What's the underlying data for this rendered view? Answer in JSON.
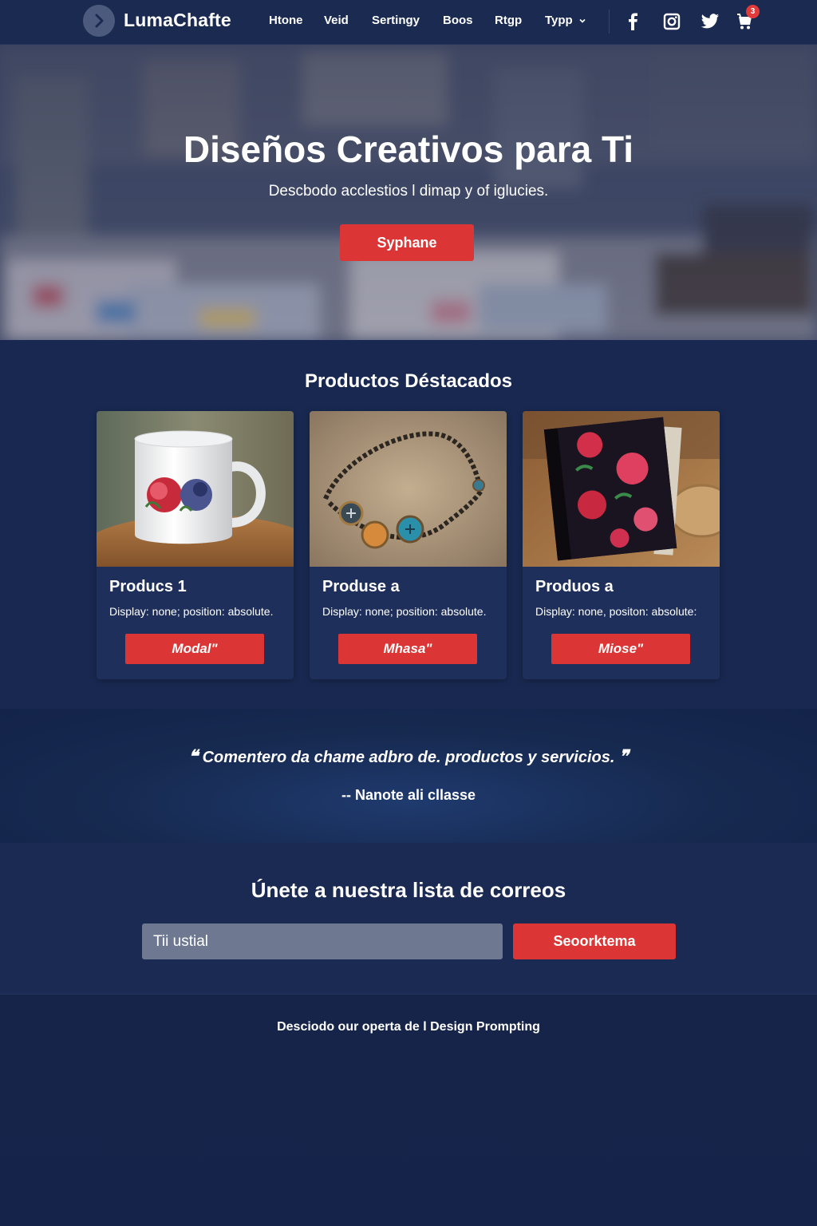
{
  "nav": {
    "brand": "LumaChafte",
    "items": [
      {
        "label": "Htone"
      },
      {
        "label": "Veid"
      },
      {
        "label": "Sertingy"
      },
      {
        "label": "Boos"
      },
      {
        "label": "Rtgp"
      },
      {
        "label": "Typp"
      }
    ],
    "social_icons": [
      "facebook-icon",
      "instagram-icon",
      "twitter-icon",
      "cart-icon"
    ],
    "cart_badge": "3"
  },
  "hero": {
    "title": "Diseños Creativos para Ti",
    "subtitle": "Descbodo acclestios l dimap y of iglucies.",
    "cta_label": "Syphane"
  },
  "products": {
    "heading": "Productos Déstacados",
    "items": [
      {
        "title": "Producs 1",
        "desc": "Display: none; position: absolute.",
        "button": "Modal\"",
        "image": "floral-mug"
      },
      {
        "title": "Produse a",
        "desc": "Display: none; position: absolute.",
        "button": "Mhasa\"",
        "image": "beaded-necklace"
      },
      {
        "title": "Produos a",
        "desc": "Display: none, positon: absolute:",
        "button": "Miose\"",
        "image": "floral-notebook"
      }
    ]
  },
  "testimonial": {
    "quote": "Comentero da chame adbro de. productos y servicios.",
    "open_mark": "❝",
    "close_mark": "❞",
    "author": "-- Nanote ali cllasse"
  },
  "newsletter": {
    "heading": "Únete a nuestra lista de correos",
    "placeholder": "Tii ustial",
    "button": "Seoorktema"
  },
  "footer": {
    "text": "Desciodo our operta de l Design Prompting"
  },
  "colors": {
    "background": "#17264d",
    "accent_red": "#dc3535",
    "card": "#1e2f5b"
  }
}
